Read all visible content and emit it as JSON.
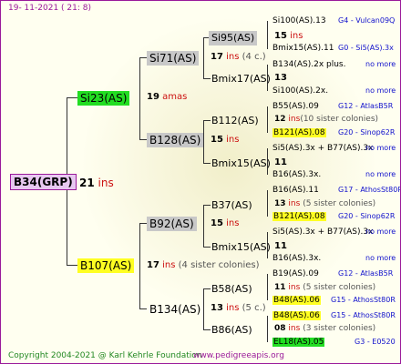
{
  "header": {
    "date": "19-  11-2021  (  21:  8)"
  },
  "root": {
    "name": "B34(GRP)",
    "num": "21",
    "ins": "ins"
  },
  "g1": [
    {
      "name": "Si23(AS)",
      "num": "19",
      "note": "amas"
    },
    {
      "name": "B107(AS)",
      "num": "17",
      "ins": "ins",
      "note": "(4 sister colonies)"
    }
  ],
  "g2": [
    {
      "name": "Si71(AS)",
      "num": "17",
      "ins": "ins",
      "note": "(4 c.)"
    },
    {
      "name": "B128(AS)",
      "num": "15",
      "ins": "ins"
    },
    {
      "name": "B92(AS)",
      "num": "15",
      "ins": "ins"
    },
    {
      "name": "B134(AS)",
      "num": "13",
      "ins": "ins",
      "note": "(5 c.)"
    }
  ],
  "g3": [
    {
      "name": "Si95(AS)",
      "num": "15",
      "ins": "ins"
    },
    {
      "name": "Bmix17(AS)",
      "num": "13"
    },
    {
      "name": "B112(AS)",
      "num": "12",
      "ins": "ins",
      "note": "(10 sister colonies)"
    },
    {
      "name": "Bmix15(AS)",
      "num": "11"
    },
    {
      "name": "B37(AS)",
      "num": "13",
      "ins": "ins",
      "note": "(5 sister colonies)"
    },
    {
      "name": "Bmix15(AS)",
      "num": "11"
    },
    {
      "name": "B58(AS)",
      "num": "11",
      "ins": "ins",
      "note": "(5 sister colonies)"
    },
    {
      "name": "B86(AS)",
      "num": "08",
      "ins": "ins",
      "note": "(3 sister colonies)"
    }
  ],
  "g4": [
    {
      "name": "Si100(AS).13",
      "info": "G4 - Vulcan09Q"
    },
    {
      "name": "Bmix15(AS).11",
      "info": "G0 - Si5(AS).3x"
    },
    {
      "name": "B134(AS).2x plus.",
      "info": "no more"
    },
    {
      "name": "Si100(AS).2x.",
      "info": "no more"
    },
    {
      "name": "B55(AS).09",
      "info": "G12 - AtlasB5R"
    },
    {
      "name": "B121(AS).08",
      "info": "G20 - Sinop62R"
    },
    {
      "name": "Si5(AS).3x + B77(AS).3x",
      "info": "no more"
    },
    {
      "name": "B16(AS).3x.",
      "info": "no more"
    },
    {
      "name": "B16(AS).11",
      "info": "G17 - AthosSt80R"
    },
    {
      "name": "B121(AS).08",
      "info": "G20 - Sinop62R"
    },
    {
      "name": "Si5(AS).3x + B77(AS).3x",
      "info": "no more"
    },
    {
      "name": "B16(AS).3x.",
      "info": "no more"
    },
    {
      "name": "B19(AS).09",
      "info": "G12 - AtlasB5R"
    },
    {
      "name": "B48(AS).06",
      "info": "G15 - AthosSt80R"
    },
    {
      "name": "B48(AS).06",
      "info": "G15 - AthosSt80R"
    },
    {
      "name": "EL18(AS).05",
      "info": "G3 - E0520"
    }
  ],
  "footer": {
    "copyright": "Copyright 2004-2021 @ Karl Kehrle Foundation",
    "site": "www.pedigreeapis.org"
  }
}
